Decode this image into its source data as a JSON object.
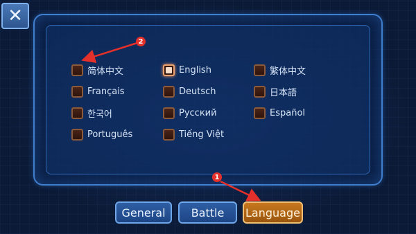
{
  "close": {
    "icon": "close-icon",
    "glyph": "✕"
  },
  "languages": [
    {
      "label": "简体中文",
      "checked": false
    },
    {
      "label": "English",
      "checked": true
    },
    {
      "label": "繁体中文",
      "checked": false
    },
    {
      "label": "Français",
      "checked": false
    },
    {
      "label": "Deutsch",
      "checked": false
    },
    {
      "label": "日本語",
      "checked": false
    },
    {
      "label": "한국어",
      "checked": false
    },
    {
      "label": "Русский",
      "checked": false
    },
    {
      "label": "Español",
      "checked": false
    },
    {
      "label": "Português",
      "checked": false
    },
    {
      "label": "Tiếng Việt",
      "checked": false
    }
  ],
  "tabs": [
    {
      "label": "General",
      "active": false
    },
    {
      "label": "Battle",
      "active": false
    },
    {
      "label": "Language",
      "active": true
    }
  ],
  "annotations": [
    {
      "number": "1",
      "color": "#e4302a"
    },
    {
      "number": "2",
      "color": "#e4302a"
    }
  ],
  "colors": {
    "panel_border": "#3f7fd0",
    "tab_active": "#c8781e",
    "checkbox_border": "#8a5a3a"
  }
}
